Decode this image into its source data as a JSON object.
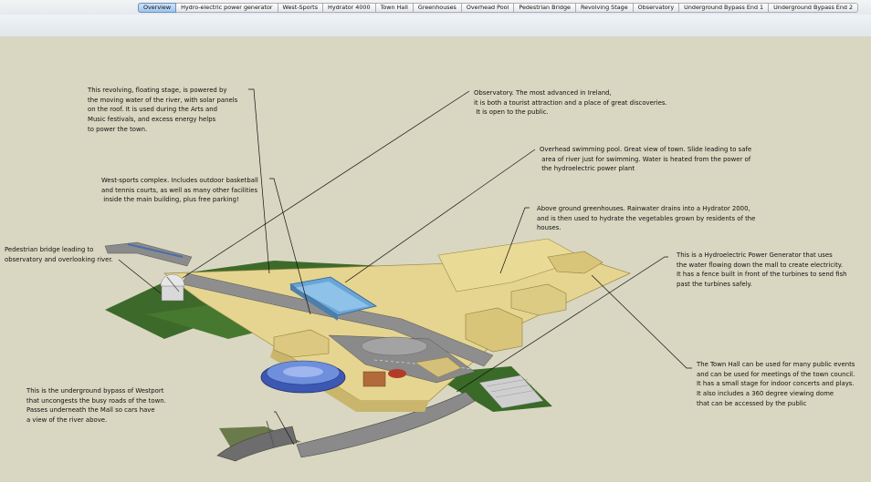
{
  "tabs": [
    {
      "label": "Overview",
      "active": true
    },
    {
      "label": "Hydro-electric power generator",
      "active": false
    },
    {
      "label": "West-Sports",
      "active": false
    },
    {
      "label": "Hydrator 4000",
      "active": false
    },
    {
      "label": "Town Hall",
      "active": false
    },
    {
      "label": "Greenhouses",
      "active": false
    },
    {
      "label": "Overhead Pool",
      "active": false
    },
    {
      "label": "Pedestrian Bridge",
      "active": false
    },
    {
      "label": "Revolving Stage",
      "active": false
    },
    {
      "label": "Observatory",
      "active": false
    },
    {
      "label": "Underground Bypass End 1",
      "active": false
    },
    {
      "label": "Underground Bypass End 2",
      "active": false
    }
  ],
  "annotations": {
    "stage": "This revolving, floating stage, is powered by\nthe moving water of the river, with solar panels\non the roof. It is used during the Arts and\nMusic festivals, and excess energy helps\nto power the town.",
    "observatory": "Observatory. The most advanced in Ireland,\nit is both a tourist attraction and a place of great discoveries.\n It is open to the public.",
    "pool": "Overhead swimming pool. Great view of town. Slide leading to safe\n area of river just for swimming. Water is heated from the power of\n the hydroelectric power plant",
    "sports": "West-sports complex. Includes outdoor basketball\nand tennis courts, as well as many other facilities\n inside the main building, plus free parking!",
    "greenhouses": "Above ground greenhouses. Rainwater drains into a Hydrator 2000,\nand is then used to hydrate the vegetables grown by residents of the\nhouses.",
    "bridge": "Pedestrian bridge leading to\nobservatory and overlooking river.",
    "hydro": "This is a Hydroelectric Power Generator that uses\nthe water flowing down the mall to create electricity.\nIt has a fence built in front of the turbines to send fish\npast the turbines safely.",
    "bypass": "This is the underground bypass of Westport\nthat uncongests the busy roads of the town.\nPasses underneath the Mall so cars have\na view of the river above.",
    "townhall": "The Town Hall can be used for many public events\nand can be used for meetings of the town council.\nIt has a small stage for indoor concerts and plays.\nIt also includes a 360 degree viewing dome\nthat can be accessed by the public"
  }
}
